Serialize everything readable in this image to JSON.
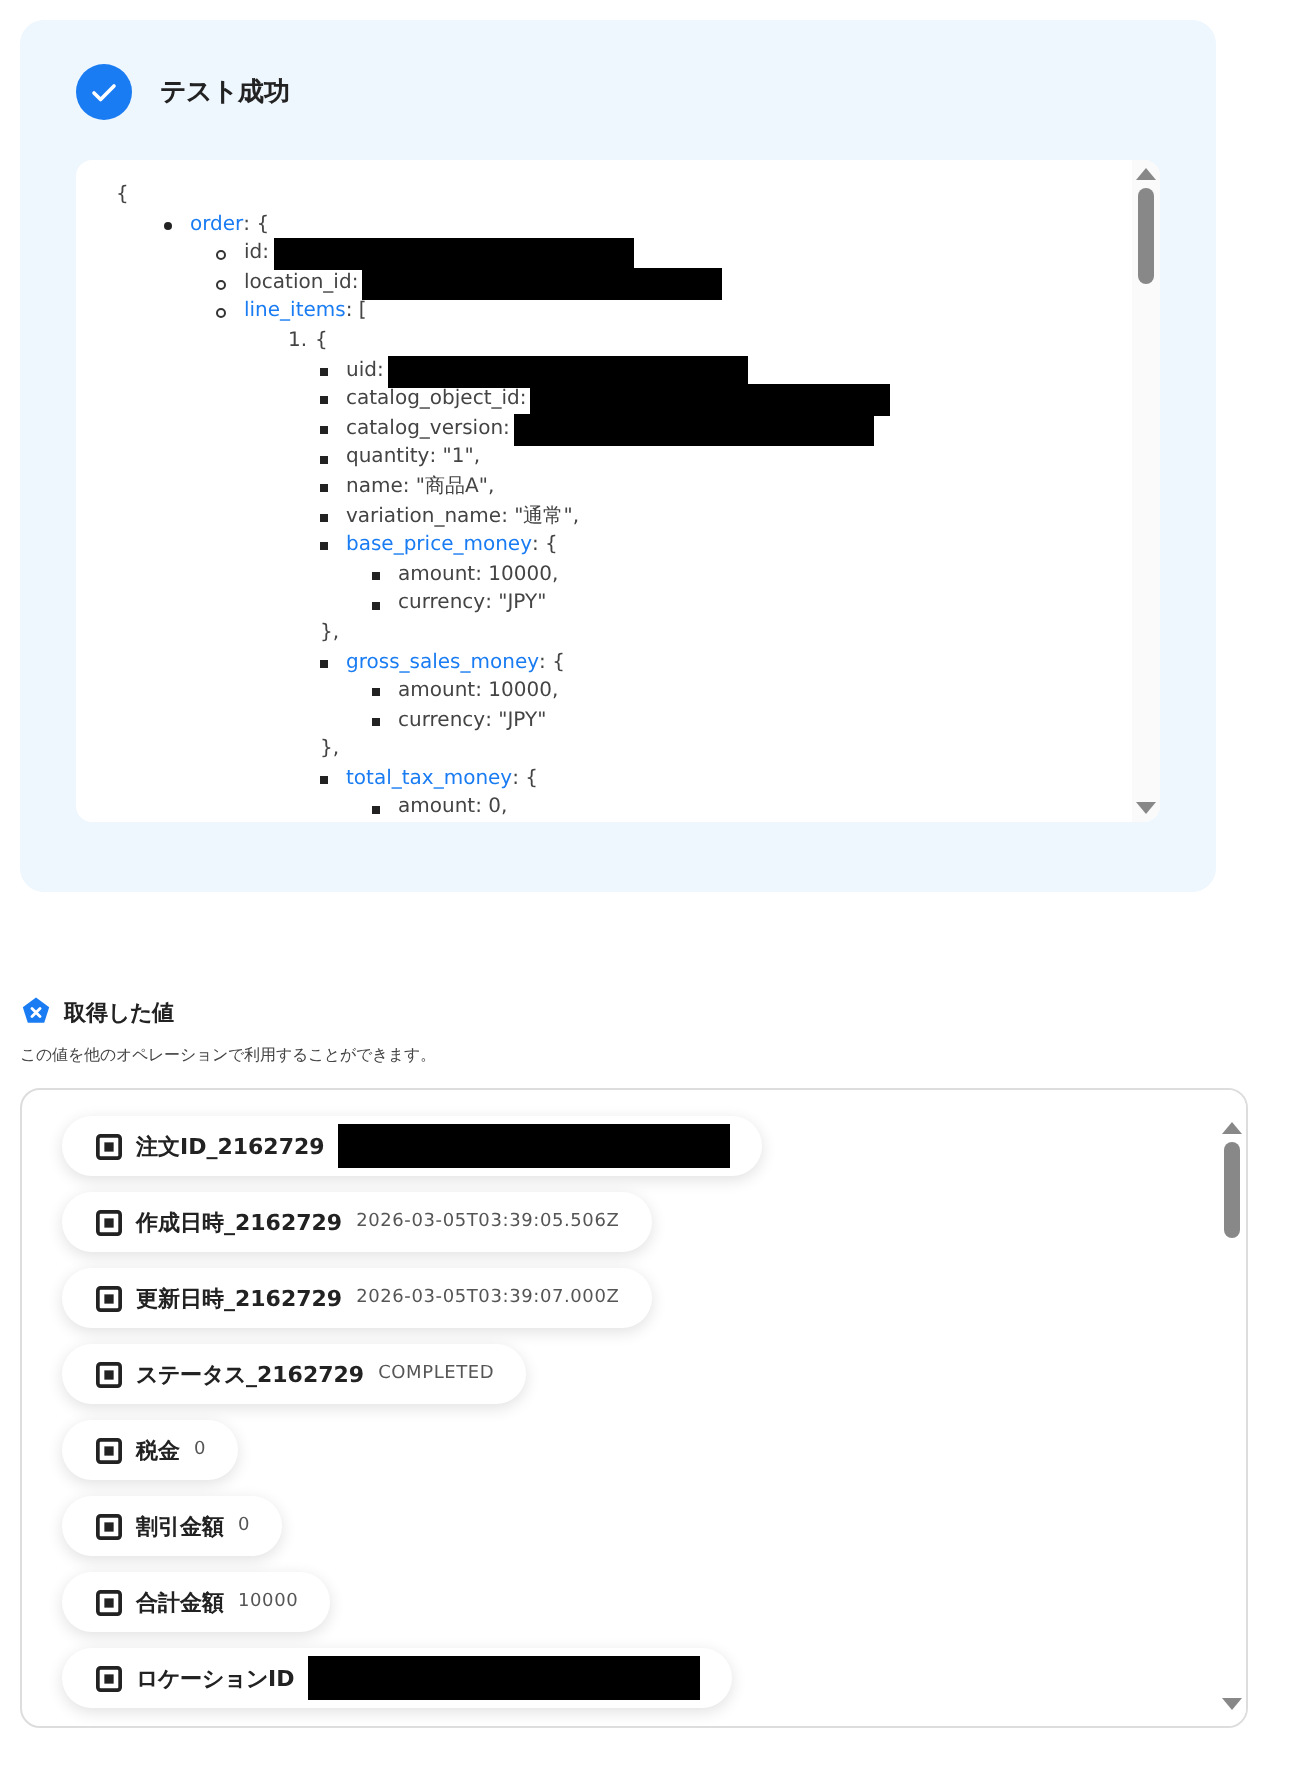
{
  "result": {
    "title": "テスト成功",
    "success": true,
    "open": "{",
    "tree": [
      {
        "key": "order",
        "value": ": {",
        "children": [
          {
            "key": "id",
            "value": ":",
            "redacted": true
          },
          {
            "key": "location_id",
            "value": ":",
            "redacted": true
          },
          {
            "key": "line_items",
            "value": ": [",
            "children": [
              {
                "marker": "1.",
                "value": "{",
                "children": [
                  {
                    "key": "uid",
                    "value": ":",
                    "redacted": true
                  },
                  {
                    "key": "catalog_object_id",
                    "value": ":",
                    "redacted": true
                  },
                  {
                    "key": "catalog_version",
                    "value": ":",
                    "redacted": true
                  },
                  {
                    "key": "quantity",
                    "value": ": \"1\","
                  },
                  {
                    "key": "name",
                    "value": ": \"商品A\","
                  },
                  {
                    "key": "variation_name",
                    "value": ": \"通常\","
                  },
                  {
                    "key": "base_price_money",
                    "value": ": {",
                    "close": "},",
                    "children": [
                      {
                        "key": "amount",
                        "value": ": 10000,"
                      },
                      {
                        "key": "currency",
                        "value": ": \"JPY\""
                      }
                    ]
                  },
                  {
                    "key": "gross_sales_money",
                    "value": ": {",
                    "close": "},",
                    "children": [
                      {
                        "key": "amount",
                        "value": ": 10000,"
                      },
                      {
                        "key": "currency",
                        "value": ": \"JPY\""
                      }
                    ]
                  },
                  {
                    "key": "total_tax_money",
                    "value": ": {",
                    "children": [
                      {
                        "key": "amount",
                        "value": ": 0,"
                      }
                    ]
                  }
                ]
              }
            ]
          }
        ]
      }
    ]
  },
  "values": {
    "title": "取得した値",
    "description": "この値を他のオペレーションで利用することができます。",
    "items": [
      {
        "label": "注文ID_2162729",
        "redacted": true
      },
      {
        "label": "作成日時_2162729",
        "value": "2026-03-05T03:39:05.506Z"
      },
      {
        "label": "更新日時_2162729",
        "value": "2026-03-05T03:39:07.000Z"
      },
      {
        "label": "ステータス_2162729",
        "value": "COMPLETED"
      },
      {
        "label": "税金",
        "value": "0"
      },
      {
        "label": "割引金額",
        "value": "0"
      },
      {
        "label": "合計金額",
        "value": "10000"
      },
      {
        "label": "ロケーションID",
        "redacted": true
      }
    ]
  }
}
